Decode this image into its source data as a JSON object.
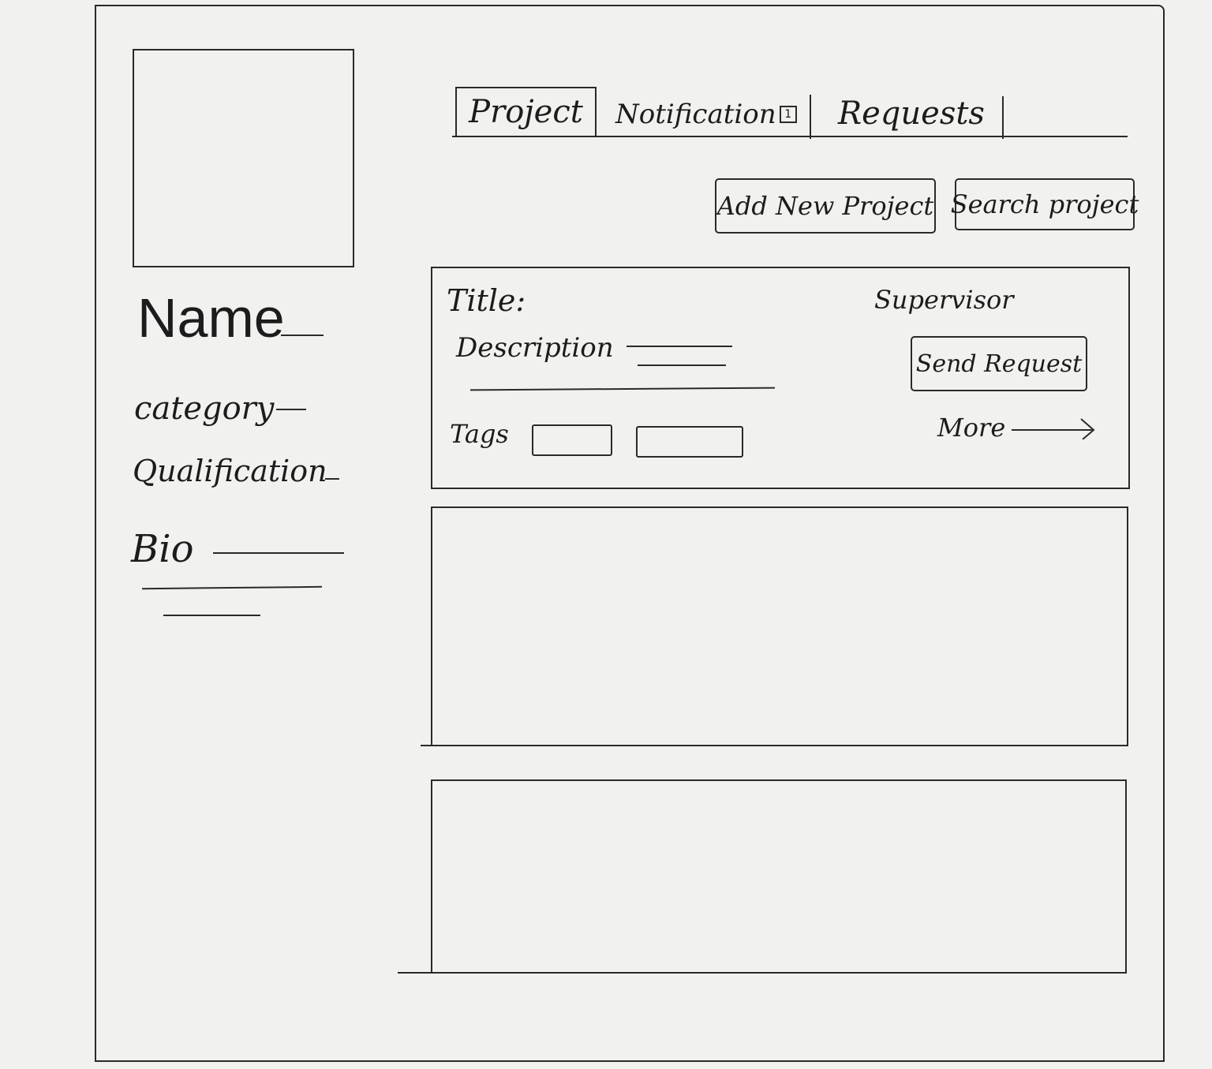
{
  "profile": {
    "name_label": "Name",
    "category_label": "category",
    "qualification_label": "Qualification",
    "bio_label": "Bio"
  },
  "tabs": [
    {
      "label": "Project",
      "active": true
    },
    {
      "label": "Notification",
      "badge": "1"
    },
    {
      "label": "Requests"
    }
  ],
  "actions": {
    "add_label": "Add New Project",
    "search_label": "Search project"
  },
  "project_card": {
    "title_label": "Title:",
    "description_label": "Description",
    "tags_label": "Tags",
    "supervisor_label": "Supervisor",
    "send_request_label": "Send Request",
    "more_label": "More"
  },
  "icons": {
    "avatar": "avatar-placeholder",
    "more_arrow": "arrow-right-icon"
  }
}
